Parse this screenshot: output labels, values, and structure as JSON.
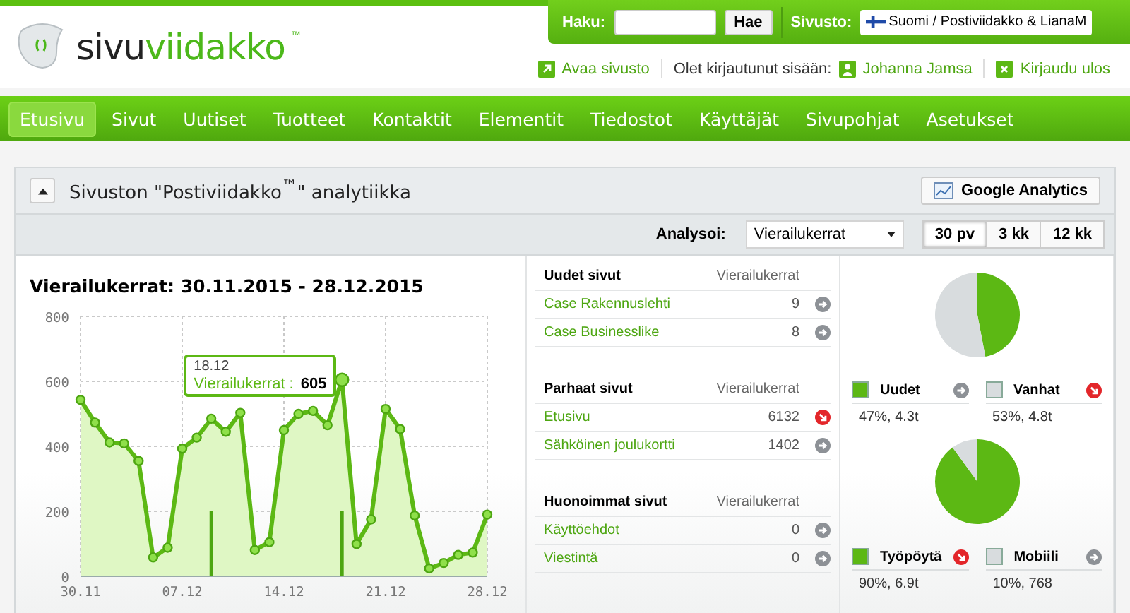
{
  "logo": {
    "part1": "sivu",
    "part2": "viidakko",
    "mark": "™"
  },
  "search": {
    "label": "Haku:",
    "button": "Hae"
  },
  "site": {
    "label": "Sivusto:",
    "value": "Suomi / Postiviidakko & LianaM"
  },
  "user_bar": {
    "open_site": "Avaa sivusto",
    "logged_in_label": "Olet kirjautunut sisään:",
    "user": "Johanna Jamsa",
    "logout": "Kirjaudu ulos"
  },
  "nav": [
    {
      "label": "Etusivu",
      "selected": true
    },
    {
      "label": "Sivut",
      "selected": false
    },
    {
      "label": "Uutiset",
      "selected": false
    },
    {
      "label": "Tuotteet",
      "selected": false
    },
    {
      "label": "Kontaktit",
      "selected": false
    },
    {
      "label": "Elementit",
      "selected": false
    },
    {
      "label": "Tiedostot",
      "selected": false
    },
    {
      "label": "Käyttäjät",
      "selected": false
    },
    {
      "label": "Sivupohjat",
      "selected": false
    },
    {
      "label": "Asetukset",
      "selected": false
    }
  ],
  "panel": {
    "title": "Sivuston \"Postiviidakko$^{™}$\" analytiikka",
    "ga_button": "Google Analytics",
    "analyze_label": "Analysoi:",
    "analyze_value": "Vierailukerrat",
    "periods": [
      {
        "label": "30 pv",
        "selected": true
      },
      {
        "label": "3 kk",
        "selected": false
      },
      {
        "label": "12 kk",
        "selected": false
      }
    ]
  },
  "visits_chart": {
    "title": "Vierailukerrat: 30.11.2015 - 28.12.2015",
    "tooltip": {
      "date": "18.12",
      "label": "Vierailukerrat :",
      "value": "605"
    },
    "chart_data": {
      "type": "area",
      "grid": true,
      "categories": [
        "30.11",
        null,
        null,
        null,
        null,
        null,
        null,
        "07.12",
        null,
        null,
        null,
        null,
        null,
        null,
        "14.12",
        null,
        null,
        null,
        null,
        null,
        null,
        "21.12",
        null,
        null,
        null,
        null,
        null,
        null,
        "28.12"
      ],
      "series": [
        {
          "color": "#5cb814",
          "values": [
            543,
            473,
            412,
            409,
            355,
            58,
            88,
            393,
            427,
            485,
            445,
            503,
            81,
            105,
            450,
            500,
            509,
            465,
            605,
            99,
            175,
            515,
            453,
            187,
            24,
            41,
            66,
            73,
            190
          ]
        }
      ],
      "ylim": [
        0,
        800
      ],
      "yticks": [
        0,
        200,
        400,
        600,
        800
      ]
    }
  },
  "tables": [
    {
      "heading": "Uudet sivut",
      "column": "Vierailukerrat",
      "rows": [
        {
          "page": "Case Rakennuslehti",
          "visits": "9",
          "kind": "neutral"
        },
        {
          "page": "Case Businesslike",
          "visits": "8",
          "kind": "neutral"
        }
      ]
    },
    {
      "heading": "Parhaat sivut",
      "column": "Vierailukerrat",
      "rows": [
        {
          "page": "Etusivu",
          "visits": "6132",
          "kind": "down"
        },
        {
          "page": "Sähköinen joulukortti",
          "visits": "1402",
          "kind": "neutral"
        }
      ]
    },
    {
      "heading": "Huonoimmat sivut",
      "column": "Vierailukerrat",
      "rows": [
        {
          "page": "Käyttöehdot",
          "visits": "0",
          "kind": "neutral"
        },
        {
          "page": "Viestintä",
          "visits": "0",
          "kind": "neutral"
        }
      ]
    }
  ],
  "pies": [
    {
      "chart_data": {
        "type": "pie",
        "categories": [
          "Uudet",
          "Vanhat"
        ],
        "values": [
          47,
          53
        ]
      },
      "legend": [
        {
          "value": "47%, 4.3t",
          "color": "#5cb814",
          "kind": "neutral"
        },
        {
          "value": "53%, 4.8t",
          "color": "#d8dcde",
          "kind": "down"
        }
      ]
    },
    {
      "chart_data": {
        "type": "pie",
        "categories": [
          "Työpöytä",
          "Mobiili"
        ],
        "values": [
          90,
          10
        ]
      },
      "legend": [
        {
          "value": "90%, 6.9t",
          "color": "#5cb814",
          "kind": "down"
        },
        {
          "value": "10%, 768",
          "color": "#d8dcde",
          "kind": "neutral"
        }
      ]
    }
  ]
}
